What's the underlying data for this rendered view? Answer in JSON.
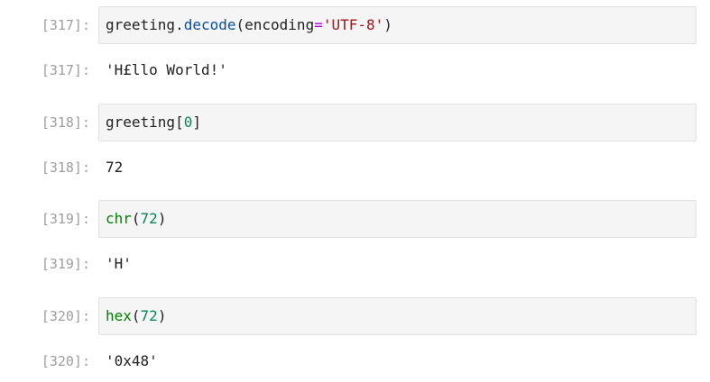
{
  "cells": [
    {
      "input_prompt": "[317]:",
      "code": {
        "part1": "greeting",
        "part2": ".",
        "part3": "decode",
        "part4": "(encoding",
        "part5": "=",
        "part6": "'UTF-8'",
        "part7": ")"
      },
      "output_prompt": "[317]:",
      "output": "'H£llo World!'"
    },
    {
      "input_prompt": "[318]:",
      "code": {
        "part1": "greeting[",
        "part2": "0",
        "part3": "]"
      },
      "output_prompt": "[318]:",
      "output": "72"
    },
    {
      "input_prompt": "[319]:",
      "code": {
        "part1": "chr",
        "part2": "(",
        "part3": "72",
        "part4": ")"
      },
      "output_prompt": "[319]:",
      "output": "'H'"
    },
    {
      "input_prompt": "[320]:",
      "code": {
        "part1": "hex",
        "part2": "(",
        "part3": "72",
        "part4": ")"
      },
      "output_prompt": "[320]:",
      "output": "'0x48'"
    }
  ],
  "colors": {
    "prompt": "#9e9e9e",
    "input_bg": "#f5f5f5",
    "input_border": "#e0e0e0",
    "function": "#0451a5",
    "builtin": "#008000",
    "operator": "#af00db",
    "string": "#a31515",
    "number": "#098658"
  }
}
